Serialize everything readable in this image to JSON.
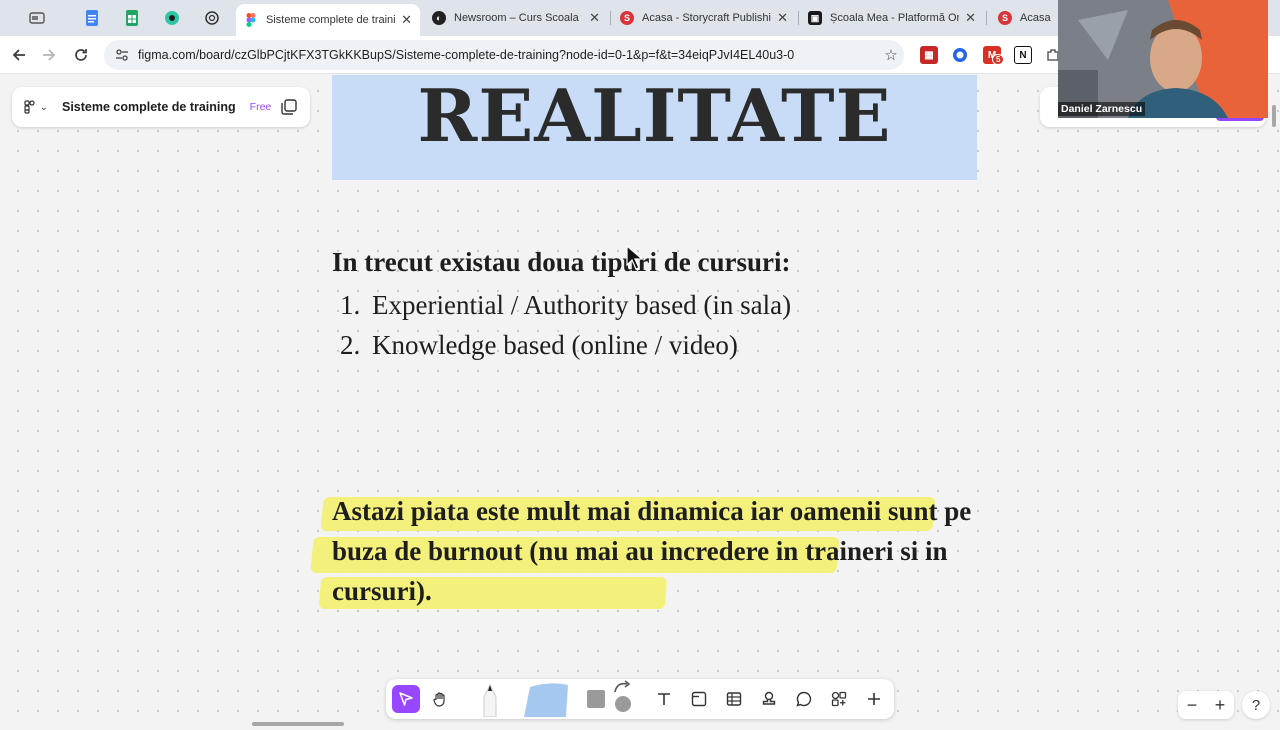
{
  "browser": {
    "tabs": [
      {
        "title": "Sisteme complete de training",
        "active": true,
        "favicon": "figma-icon"
      },
      {
        "title": "Newsroom – Curs Scoala",
        "active": false,
        "favicon": "newsroom-icon"
      },
      {
        "title": "Acasa - Storycraft Publishing",
        "active": false,
        "favicon": "s-icon"
      },
      {
        "title": "Școala Mea - Platformă Online",
        "active": false,
        "favicon": "school-icon"
      },
      {
        "title": "Acasa -",
        "active": false,
        "favicon": "s-icon"
      }
    ],
    "url": "figma.com/board/czGlbPCjtKFX3TGkKKBupS/Sisteme-complete-de-training?node-id=0-1&p=f&t=34eiqPJvI4EL40u3-0",
    "extension_badge": "5"
  },
  "file": {
    "name": "Sisteme complete de training",
    "plan": "Free"
  },
  "content": {
    "banner_title": "REALITATE",
    "heading": "In trecut existau doua tipuri de cursuri:",
    "list": [
      {
        "num": "1.",
        "text": "Experiential / Authority based (in sala)"
      },
      {
        "num": "2.",
        "text": "Knowledge based (online / video)"
      }
    ],
    "paragraph": "Astazi piata este mult mai dinamica iar oamenii sunt pe buza de burnout (nu  mai au incredere in traineri si in cursuri)."
  },
  "webcam": {
    "name": "Daniel Zarnescu"
  },
  "zoom": {
    "minus": "−",
    "plus": "+"
  },
  "help": "?",
  "colors": {
    "banner": "#c8dcf7",
    "highlight": "#f3f06e",
    "figma_accent": "#9747ff"
  }
}
